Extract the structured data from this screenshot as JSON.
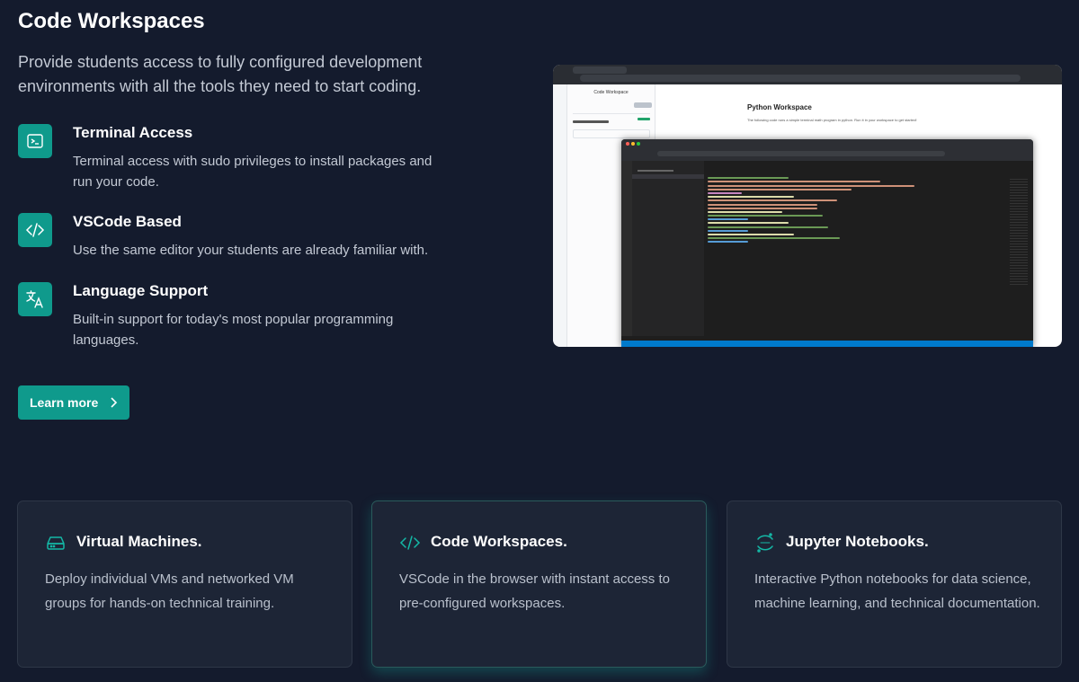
{
  "header": {
    "title": "Code Workspaces",
    "intro": "Provide students access to fully configured development environments with all the tools they need to start coding."
  },
  "features": [
    {
      "icon": "terminal-icon",
      "title": "Terminal Access",
      "desc": "Terminal access with sudo privileges to install packages and run your code."
    },
    {
      "icon": "code-icon",
      "title": "VSCode Based",
      "desc": "Use the same editor your students are already familiar with."
    },
    {
      "icon": "translate-icon",
      "title": "Language Support",
      "desc": "Built-in support for today's most popular programming languages."
    }
  ],
  "cta": {
    "label": "Learn more"
  },
  "screenshot": {
    "panel_title": "Code Workspace",
    "workspace_title": "Python Workspace",
    "workspace_desc": "The following code runs a simple terminal math program in python. Run it in your workspace to get started!"
  },
  "cards": [
    {
      "icon": "server-icon",
      "title": "Virtual Machines.",
      "desc": "Deploy individual VMs and networked VM groups for hands-on technical training."
    },
    {
      "icon": "code-icon",
      "title": "Code Workspaces.",
      "desc": "VSCode in the browser with instant access to pre-configured workspaces."
    },
    {
      "icon": "jupyter-icon",
      "title": "Jupyter Notebooks.",
      "desc": "Interactive Python notebooks for data science, machine learning, and technical documentation."
    }
  ],
  "colors": {
    "background": "#141b2d",
    "accent": "#0f9a8c",
    "card": "#1d2536"
  }
}
